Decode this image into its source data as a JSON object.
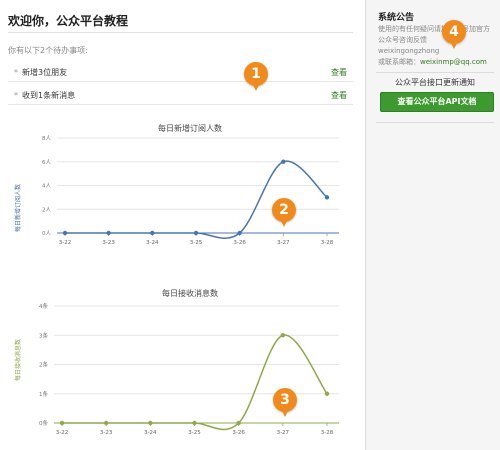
{
  "header": {
    "title": "欢迎你，公众平台教程",
    "subtitle": "你有以下2个待办事项:"
  },
  "todos": [
    {
      "label": "新增3位朋友",
      "action": "查看"
    },
    {
      "label": "收到1条新消息",
      "action": "查看"
    }
  ],
  "charts": {
    "subscribers": {
      "title": "每日新增订阅人数",
      "ylabel": "每日新增订阅人数"
    },
    "messages": {
      "title": "每日接收消息数",
      "ylabel": "每日接收消息数"
    }
  },
  "chart_data": [
    {
      "type": "line",
      "title": "每日新增订阅人数",
      "ylabel": "每日新增订阅人数",
      "x": [
        "3-22",
        "3-23",
        "3-24",
        "3-25",
        "3-26",
        "3-27",
        "3-28"
      ],
      "values": [
        0,
        0,
        0,
        0,
        0,
        6,
        3
      ],
      "ylim": [
        0,
        8
      ],
      "yticks": [
        "0人",
        "2人",
        "4人",
        "6人",
        "8人"
      ],
      "color": "#4a74b0"
    },
    {
      "type": "line",
      "title": "每日接收消息数",
      "ylabel": "每日接收消息数",
      "x": [
        "3-22",
        "3-23",
        "3-24",
        "3-25",
        "3-26",
        "3-27",
        "3-28"
      ],
      "values": [
        0,
        0,
        0,
        0,
        0,
        3,
        1
      ],
      "ylim": [
        0,
        4
      ],
      "yticks": [
        "0条",
        "1条",
        "2条",
        "3条",
        "4条"
      ],
      "color": "#8fa94a"
    }
  ],
  "sidebar": {
    "title": "系统公告",
    "notice_line1": "使用的有任何疑问请加微信号加官方公众号咨询反馈",
    "wechat": "weixingongzhong",
    "email_label": "或联系邮箱：",
    "email": "weixinmp@qq.com",
    "link": "公众平台接口更新通知",
    "button": "查看公众平台API文档"
  },
  "badges": [
    "1",
    "2",
    "3",
    "4"
  ],
  "colors": {
    "accent": "#3c9a2e",
    "badge": "#f08a1a",
    "line1": "#4a74b0",
    "line2": "#8fa94a"
  }
}
